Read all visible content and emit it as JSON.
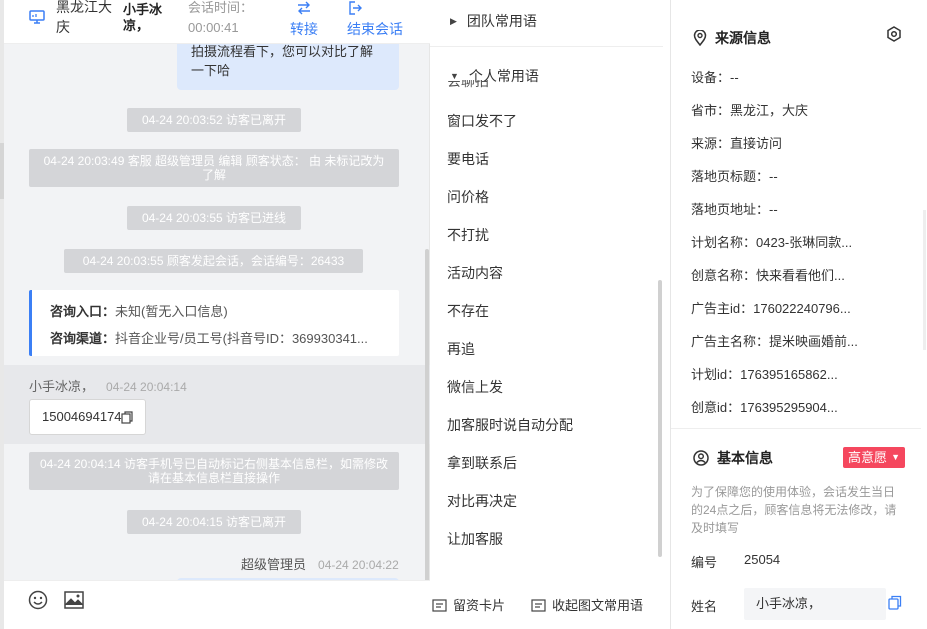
{
  "header": {
    "location": "黑龙江大庆",
    "user": "小手冰凉，",
    "timer_label": "会话时间：",
    "timer_value": "00:00:41",
    "transfer": "转接",
    "end_session": "结束会话"
  },
  "chat": {
    "top_bubble": "拍摄流程看下，您可以对比了解一下哈",
    "sys_leave1": "04-24 20:03:52 访客已离开",
    "sys_edit": "04-24 20:03:49 客服 超级管理员 编辑 顾客状态： 由 未标记改为 了解",
    "sys_enter": "04-24 20:03:55 访客已进线",
    "sys_start": "04-24 20:03:55 顾客发起会话，会话编号：26433",
    "card": {
      "entry_label": "咨询入口：",
      "entry_value": "未知(暂无入口信息)",
      "channel_label": "咨询渠道：",
      "channel_value": "抖音企业号/员工号(抖音号ID：369930341..."
    },
    "visitor_name": "小手冰凉，",
    "visitor_time": "04-24 20:04:14",
    "phone": "15004694174",
    "sys_phone": "04-24 20:04:14 访客手机号已自动标记右侧基本信息栏，如需修改请在基本信息栏直接操作",
    "sys_leave2": "04-24 20:04:15 访客已离开",
    "agent_name": "超级管理员",
    "agent_time": "04-24 20:04:22"
  },
  "phrases": {
    "team_group": "团队常用语",
    "personal_group": "个人常用语",
    "clipped_item": "会聊拍",
    "items": [
      "窗口发不了",
      "要电话",
      "问价格",
      "不打扰",
      "活动内容",
      "不存在",
      "再追",
      "微信上发",
      "加客服时说自动分配",
      "拿到联系后",
      "对比再决定",
      "让加客服"
    ],
    "btn_card": "留资卡片",
    "btn_collapse": "收起图文常用语"
  },
  "source": {
    "title": "来源信息",
    "rows": [
      {
        "k": "设备：",
        "v": "--"
      },
      {
        "k": "省市：",
        "v": "黑龙江，大庆"
      },
      {
        "k": "来源：",
        "v": "直接访问"
      },
      {
        "k": "落地页标题：",
        "v": "--"
      },
      {
        "k": "落地页地址：",
        "v": "--"
      },
      {
        "k": "计划名称：",
        "v": "0423-张琳同款..."
      },
      {
        "k": "创意名称：",
        "v": "快来看看他们..."
      },
      {
        "k": "广告主id：",
        "v": "176022240796..."
      },
      {
        "k": "广告主名称：",
        "v": "提米映画婚前..."
      },
      {
        "k": "计划id：",
        "v": "176395165862..."
      },
      {
        "k": "创意id：",
        "v": "176395295904..."
      }
    ]
  },
  "basic": {
    "title": "基本信息",
    "intent": "高意愿",
    "notice": "为了保障您的使用体验，会话发生当日的24点之后，顾客信息将无法修改，请及时填写",
    "number_label": "编号",
    "number_value": "25054",
    "name_label": "姓名",
    "name_value": "小手冰凉，"
  },
  "colors": {
    "accent": "#3b7ff5",
    "intent_bg": "#f5475e",
    "system_bubble": "#d4d5d8"
  }
}
